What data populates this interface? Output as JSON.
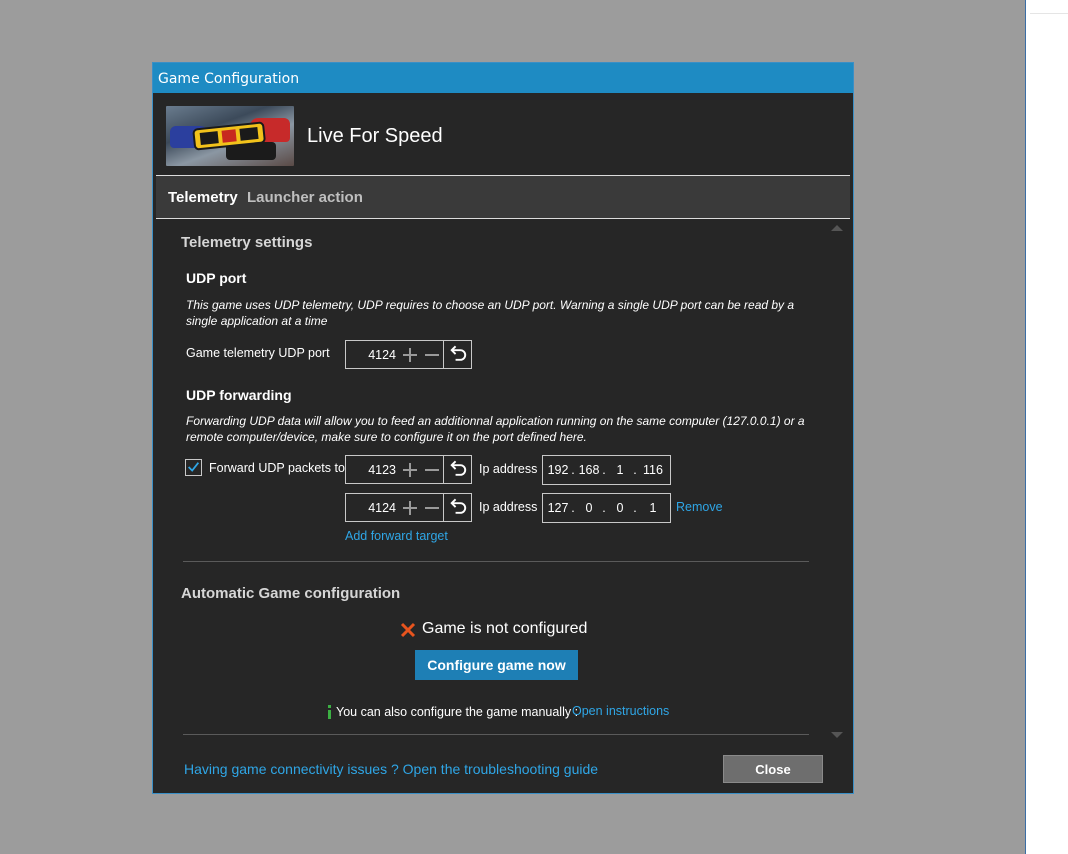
{
  "window": {
    "title": "Game Configuration"
  },
  "game": {
    "name": "Live For Speed",
    "thumbnail_icon": "live-for-speed-logo"
  },
  "tabs": [
    {
      "label": "Telemetry",
      "active": true
    },
    {
      "label": "Launcher action",
      "active": false
    }
  ],
  "telemetry": {
    "section_title": "Telemetry settings",
    "udp_port": {
      "title": "UDP port",
      "description_line1": "This game uses UDP telemetry, UDP requires to choose an UDP port. Warning a single UDP port can be read by a",
      "description_line2": "single application at a time",
      "label": "Game telemetry UDP port",
      "value": "4124"
    },
    "udp_forwarding": {
      "title": "UDP forwarding",
      "description_line1": "Forwarding UDP data will allow you to feed an additionnal application running on the same computer (127.0.0.1) or a",
      "description_line2": "remote computer/device, make sure to configure it on the port defined here.",
      "checkbox_label": "Forward UDP packets to",
      "checkbox_checked": true,
      "targets": [
        {
          "port": "4123",
          "ip_label": "Ip address",
          "ip": [
            "192",
            "168",
            "1",
            "116"
          ]
        },
        {
          "port": "4124",
          "ip_label": "Ip address",
          "ip": [
            "127",
            "0",
            "0",
            "1"
          ],
          "remove_label": "Remove"
        }
      ],
      "add_target_label": "Add forward target"
    }
  },
  "auto_config": {
    "section_title": "Automatic Game configuration",
    "status_text": "Game is not configured",
    "status_color": "#e8541e",
    "configure_button": "Configure game now",
    "manual_text": "You can also configure the game manually :",
    "manual_link": "Open instructions",
    "info_color": "#3cb043"
  },
  "footer": {
    "troubleshoot_link": "Having game connectivity issues ? Open the troubleshooting guide",
    "close_button": "Close"
  },
  "colors": {
    "accent": "#1e8bc3",
    "link": "#2fa6e6",
    "dialog_bg": "#262626",
    "backdrop": "#9c9c9c"
  }
}
